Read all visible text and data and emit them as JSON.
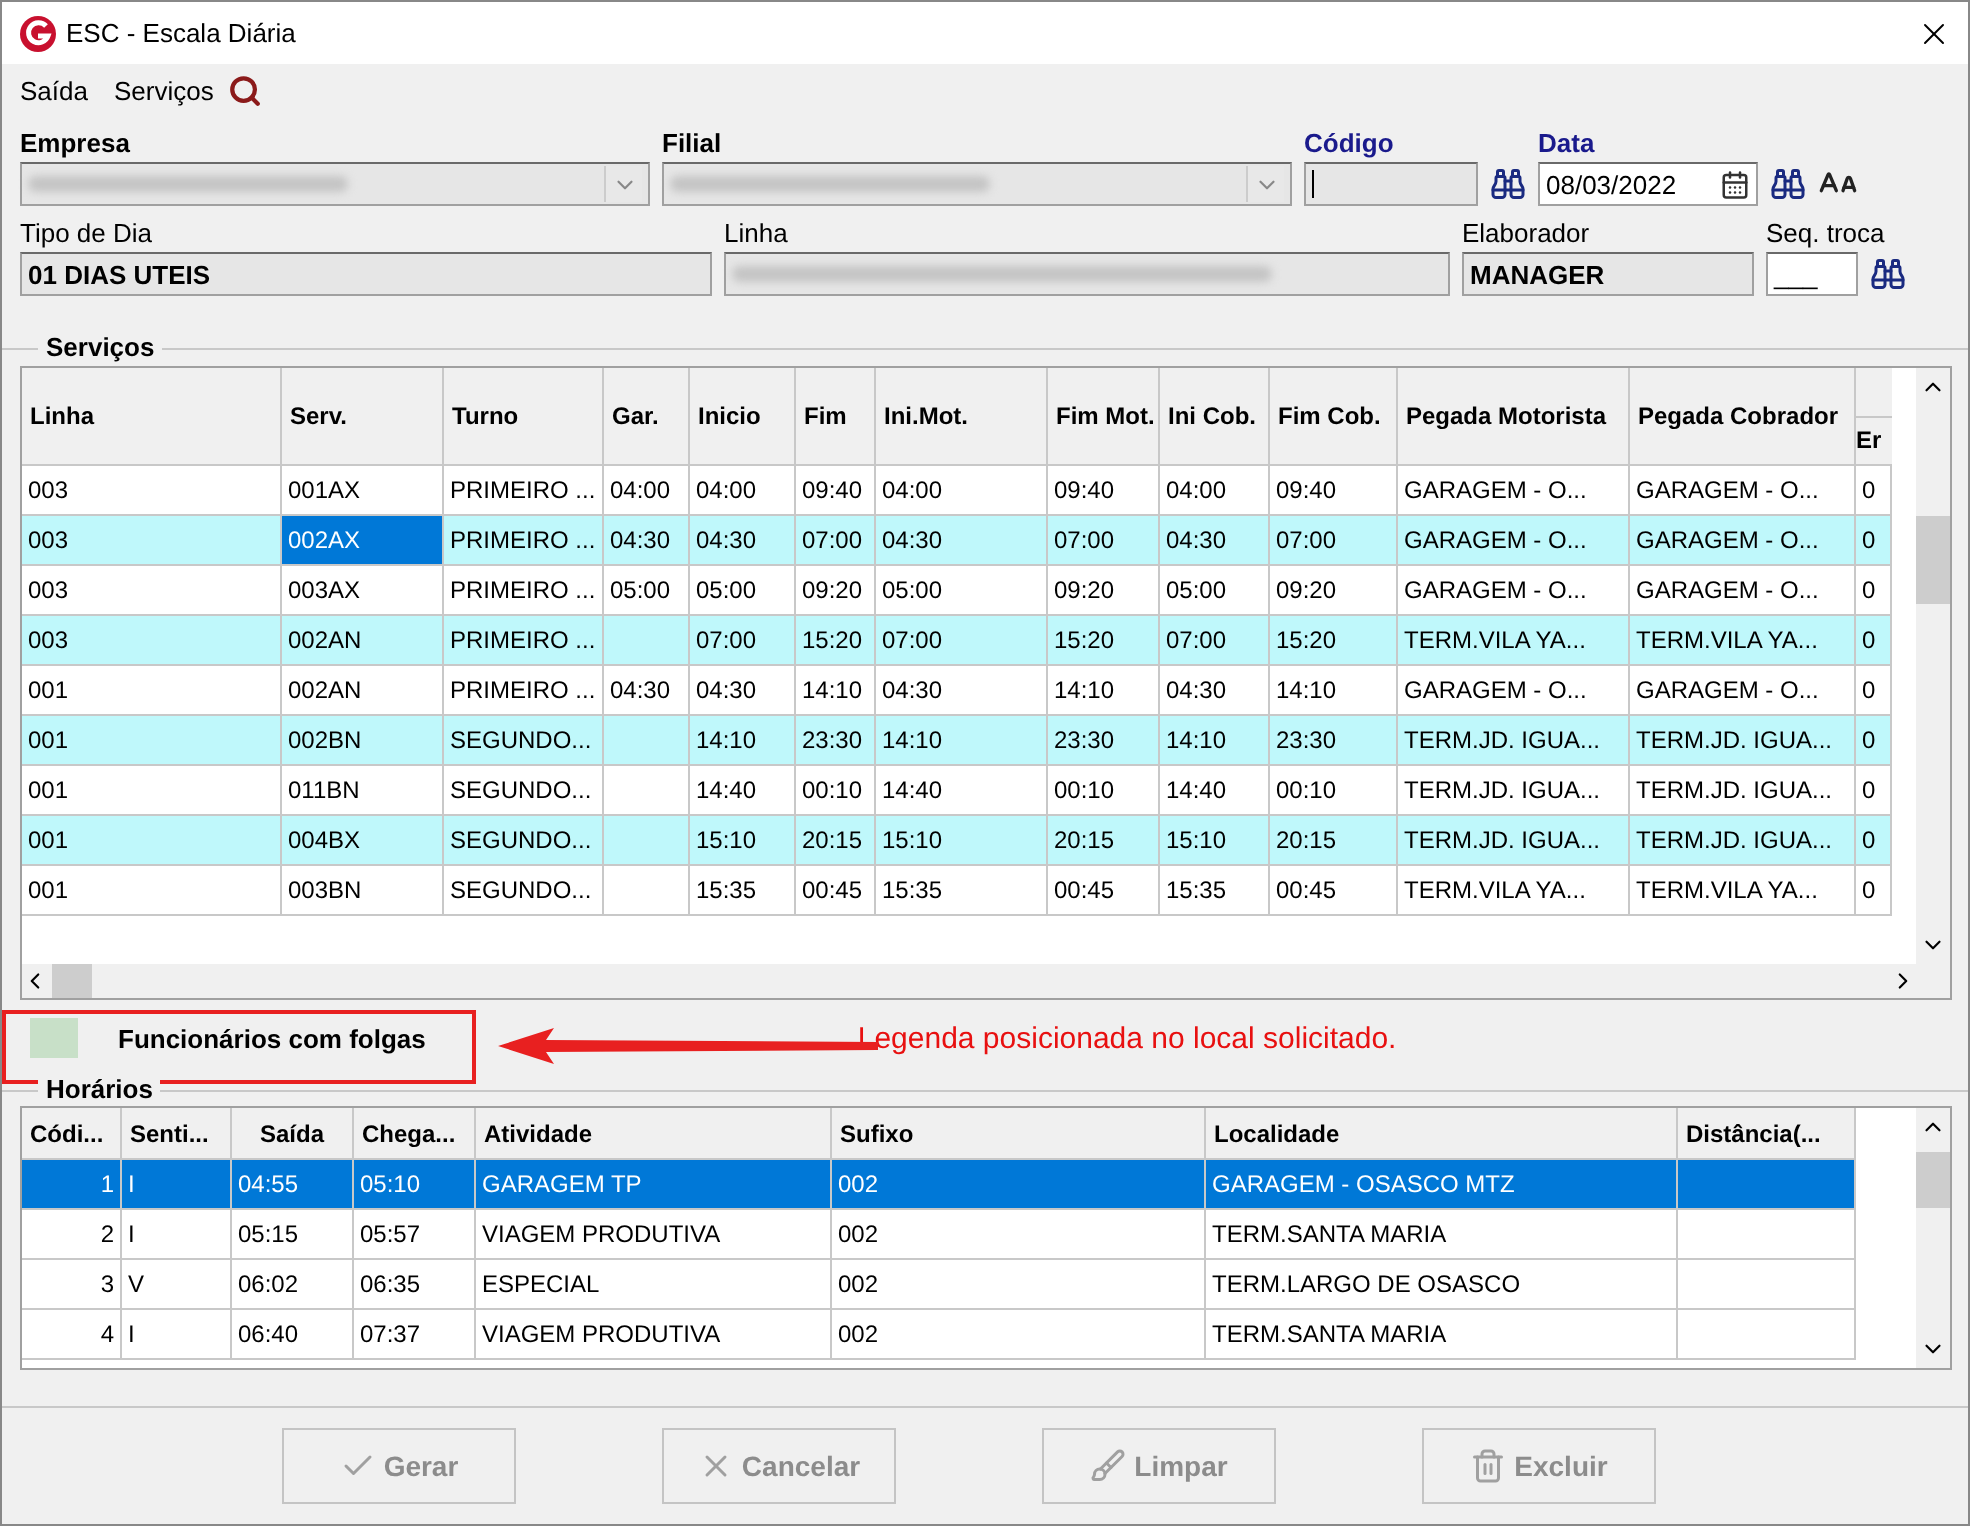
{
  "window": {
    "title": "ESC - Escala Diária"
  },
  "menu": [
    {
      "label": "Saída"
    },
    {
      "label": "Serviços"
    }
  ],
  "form": {
    "row1": [
      {
        "label": "Empresa",
        "bold": true,
        "required": false,
        "kind": "combo"
      },
      {
        "label": "Filial",
        "bold": true,
        "required": false,
        "kind": "combo"
      },
      {
        "label": "Código",
        "bold": true,
        "required": true,
        "kind": "code"
      },
      {
        "label": "Data",
        "bold": true,
        "required": true,
        "kind": "date",
        "value": "08/03/2022"
      }
    ],
    "row2": [
      {
        "label": "Tipo de Dia",
        "bold": false,
        "required": false,
        "kind": "text",
        "value": "01 DIAS UTEIS"
      },
      {
        "label": "Linha",
        "bold": false,
        "required": false,
        "kind": "blurred"
      },
      {
        "label": "Elaborador",
        "bold": false,
        "required": false,
        "kind": "text",
        "value": "MANAGER"
      },
      {
        "label": "Seq. troca",
        "bold": false,
        "required": false,
        "kind": "seq",
        "value": "___"
      }
    ]
  },
  "servicos": {
    "title": "Serviços",
    "columns": [
      "Linha",
      "Serv.",
      "Turno",
      "Gar.",
      "Inicio",
      "Fim",
      "Ini.Mot.",
      "Fim Mot.",
      "Ini Cob.",
      "Fim Cob.",
      "Pegada Motorista",
      "Pegada Cobrador",
      "Er"
    ],
    "rows": [
      {
        "highlighted": false,
        "cells": [
          {
            "text": "003",
            "selected": false
          },
          {
            "text": "001AX",
            "selected": false
          },
          {
            "text": "PRIMEIRO ...",
            "selected": false
          },
          {
            "text": "04:00",
            "selected": false
          },
          {
            "text": "04:00",
            "selected": false
          },
          {
            "text": "09:40",
            "selected": false
          },
          {
            "text": "04:00",
            "selected": false
          },
          {
            "text": "09:40",
            "selected": false
          },
          {
            "text": "04:00",
            "selected": false
          },
          {
            "text": "09:40",
            "selected": false
          },
          {
            "text": "GARAGEM - O...",
            "selected": false
          },
          {
            "text": "GARAGEM - O...",
            "selected": false
          },
          {
            "text": "0",
            "selected": false
          }
        ]
      },
      {
        "highlighted": true,
        "cells": [
          {
            "text": "003",
            "selected": false
          },
          {
            "text": "002AX",
            "selected": true
          },
          {
            "text": "PRIMEIRO ...",
            "selected": false
          },
          {
            "text": "04:30",
            "selected": false
          },
          {
            "text": "04:30",
            "selected": false
          },
          {
            "text": "07:00",
            "selected": false
          },
          {
            "text": "04:30",
            "selected": false
          },
          {
            "text": "07:00",
            "selected": false
          },
          {
            "text": "04:30",
            "selected": false
          },
          {
            "text": "07:00",
            "selected": false
          },
          {
            "text": "GARAGEM - O...",
            "selected": false
          },
          {
            "text": "GARAGEM - O...",
            "selected": false
          },
          {
            "text": "0",
            "selected": false
          }
        ]
      },
      {
        "highlighted": false,
        "cells": [
          {
            "text": "003",
            "selected": false
          },
          {
            "text": "003AX",
            "selected": false
          },
          {
            "text": "PRIMEIRO ...",
            "selected": false
          },
          {
            "text": "05:00",
            "selected": false
          },
          {
            "text": "05:00",
            "selected": false
          },
          {
            "text": "09:20",
            "selected": false
          },
          {
            "text": "05:00",
            "selected": false
          },
          {
            "text": "09:20",
            "selected": false
          },
          {
            "text": "05:00",
            "selected": false
          },
          {
            "text": "09:20",
            "selected": false
          },
          {
            "text": "GARAGEM - O...",
            "selected": false
          },
          {
            "text": "GARAGEM - O...",
            "selected": false
          },
          {
            "text": "0",
            "selected": false
          }
        ]
      },
      {
        "highlighted": true,
        "cells": [
          {
            "text": "003",
            "selected": false
          },
          {
            "text": "002AN",
            "selected": false
          },
          {
            "text": "PRIMEIRO ...",
            "selected": false
          },
          {
            "text": "",
            "selected": false
          },
          {
            "text": "07:00",
            "selected": false
          },
          {
            "text": "15:20",
            "selected": false
          },
          {
            "text": "07:00",
            "selected": false
          },
          {
            "text": "15:20",
            "selected": false
          },
          {
            "text": "07:00",
            "selected": false
          },
          {
            "text": "15:20",
            "selected": false
          },
          {
            "text": "TERM.VILA YA...",
            "selected": false
          },
          {
            "text": "TERM.VILA YA...",
            "selected": false
          },
          {
            "text": "0",
            "selected": false
          }
        ]
      },
      {
        "highlighted": false,
        "cells": [
          {
            "text": "001",
            "selected": false
          },
          {
            "text": "002AN",
            "selected": false
          },
          {
            "text": "PRIMEIRO ...",
            "selected": false
          },
          {
            "text": "04:30",
            "selected": false
          },
          {
            "text": "04:30",
            "selected": false
          },
          {
            "text": "14:10",
            "selected": false
          },
          {
            "text": "04:30",
            "selected": false
          },
          {
            "text": "14:10",
            "selected": false
          },
          {
            "text": "04:30",
            "selected": false
          },
          {
            "text": "14:10",
            "selected": false
          },
          {
            "text": "GARAGEM - O...",
            "selected": false
          },
          {
            "text": "GARAGEM - O...",
            "selected": false
          },
          {
            "text": "0",
            "selected": false
          }
        ]
      },
      {
        "highlighted": true,
        "cells": [
          {
            "text": "001",
            "selected": false
          },
          {
            "text": "002BN",
            "selected": false
          },
          {
            "text": "SEGUNDO...",
            "selected": false
          },
          {
            "text": "",
            "selected": false
          },
          {
            "text": "14:10",
            "selected": false
          },
          {
            "text": "23:30",
            "selected": false
          },
          {
            "text": "14:10",
            "selected": false
          },
          {
            "text": "23:30",
            "selected": false
          },
          {
            "text": "14:10",
            "selected": false
          },
          {
            "text": "23:30",
            "selected": false
          },
          {
            "text": "TERM.JD. IGUA...",
            "selected": false
          },
          {
            "text": "TERM.JD. IGUA...",
            "selected": false
          },
          {
            "text": "0",
            "selected": false
          }
        ]
      },
      {
        "highlighted": false,
        "cells": [
          {
            "text": "001",
            "selected": false
          },
          {
            "text": "011BN",
            "selected": false
          },
          {
            "text": "SEGUNDO...",
            "selected": false
          },
          {
            "text": "",
            "selected": false
          },
          {
            "text": "14:40",
            "selected": false
          },
          {
            "text": "00:10",
            "selected": false
          },
          {
            "text": "14:40",
            "selected": false
          },
          {
            "text": "00:10",
            "selected": false
          },
          {
            "text": "14:40",
            "selected": false
          },
          {
            "text": "00:10",
            "selected": false
          },
          {
            "text": "TERM.JD. IGUA...",
            "selected": false
          },
          {
            "text": "TERM.JD. IGUA...",
            "selected": false
          },
          {
            "text": "0",
            "selected": false
          }
        ]
      },
      {
        "highlighted": true,
        "cells": [
          {
            "text": "001",
            "selected": false
          },
          {
            "text": "004BX",
            "selected": false
          },
          {
            "text": "SEGUNDO...",
            "selected": false
          },
          {
            "text": "",
            "selected": false
          },
          {
            "text": "15:10",
            "selected": false
          },
          {
            "text": "20:15",
            "selected": false
          },
          {
            "text": "15:10",
            "selected": false
          },
          {
            "text": "20:15",
            "selected": false
          },
          {
            "text": "15:10",
            "selected": false
          },
          {
            "text": "20:15",
            "selected": false
          },
          {
            "text": "TERM.JD. IGUA...",
            "selected": false
          },
          {
            "text": "TERM.JD. IGUA...",
            "selected": false
          },
          {
            "text": "0",
            "selected": false
          }
        ]
      },
      {
        "highlighted": false,
        "cells": [
          {
            "text": "001",
            "selected": false
          },
          {
            "text": "003BN",
            "selected": false
          },
          {
            "text": "SEGUNDO...",
            "selected": false
          },
          {
            "text": "",
            "selected": false
          },
          {
            "text": "15:35",
            "selected": false
          },
          {
            "text": "00:45",
            "selected": false
          },
          {
            "text": "15:35",
            "selected": false
          },
          {
            "text": "00:45",
            "selected": false
          },
          {
            "text": "15:35",
            "selected": false
          },
          {
            "text": "00:45",
            "selected": false
          },
          {
            "text": "TERM.VILA YA...",
            "selected": false
          },
          {
            "text": "TERM.VILA YA...",
            "selected": false
          },
          {
            "text": "0",
            "selected": false
          }
        ]
      }
    ]
  },
  "legend": {
    "label": "Funcionários com folgas"
  },
  "annotation": {
    "text": "Legenda posicionada no local solicitado."
  },
  "horarios": {
    "title": "Horários",
    "columns": [
      "Códi...",
      "Senti...",
      "Saída",
      "Chega...",
      "Atividade",
      "Sufixo",
      "Localidade",
      "Distância(..."
    ],
    "rows": [
      {
        "selected": true,
        "cells": [
          "1",
          "I",
          "04:55",
          "05:10",
          "GARAGEM TP",
          "002",
          "GARAGEM - OSASCO MTZ"
        ]
      },
      {
        "selected": false,
        "cells": [
          "2",
          "I",
          "05:15",
          "05:57",
          "VIAGEM PRODUTIVA",
          "002",
          "TERM.SANTA MARIA"
        ]
      },
      {
        "selected": false,
        "cells": [
          "3",
          "V",
          "06:02",
          "06:35",
          "ESPECIAL",
          "002",
          "TERM.LARGO DE OSASCO"
        ]
      },
      {
        "selected": false,
        "cells": [
          "4",
          "I",
          "06:40",
          "07:37",
          "VIAGEM PRODUTIVA",
          "002",
          "TERM.SANTA MARIA"
        ]
      }
    ]
  },
  "buttons": [
    {
      "label": "Gerar",
      "kind": "generate",
      "disabled": true
    },
    {
      "label": "Cancelar",
      "kind": "cancel",
      "disabled": true
    },
    {
      "label": "Limpar",
      "kind": "clear",
      "disabled": true
    },
    {
      "label": "Excluir",
      "kind": "delete",
      "disabled": true
    }
  ]
}
